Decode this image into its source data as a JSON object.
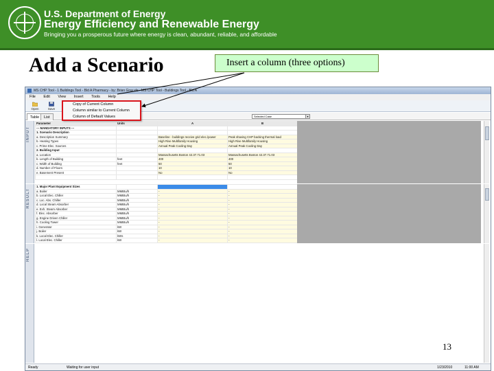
{
  "banner": {
    "line1": "U.S. Department of Energy",
    "line2": "Energy Efficiency and Renewable Energy",
    "line3": "Bringing you a prosperous future where energy is clean, abundant, reliable, and affordable",
    "color": "#3e8f27"
  },
  "slide": {
    "title": "Add a Scenario",
    "callout": "Insert a column (three options)",
    "callout_color": "#ccffcc",
    "page_number": "13",
    "highlight_color": "#d9141b"
  },
  "app": {
    "window_title": "MS CHP Tool - 1 Buildings Tool - Bld A Pharmacy - by: Brian Gray.xls - MS CHP Tool - Buildings Tool - Bld A",
    "menu": [
      "File",
      "Edit",
      "View",
      "Insert",
      "Tools",
      "Help"
    ],
    "toolbar": {
      "open": "Open",
      "save": "Save"
    },
    "dropdown_items": [
      "Copy of Current Column",
      "Column similar to Current Column",
      "Column of Default Values"
    ],
    "tabs": [
      "Table",
      "List"
    ],
    "scenario_select": "Selected Case",
    "sections": {
      "input": "INPUT",
      "result": "RESULT",
      "help": "HELP"
    },
    "columns": {
      "parameter": "Parameter",
      "units": "Units",
      "a": "A",
      "b": "B"
    },
    "input_rows": [
      {
        "p": "--- MANDATORY INPUTS ---",
        "u": "",
        "a": "",
        "b": "",
        "hdr": true
      },
      {
        "p": "1.  Scenario Description",
        "u": "",
        "a": "",
        "b": "",
        "hdr": true
      },
      {
        "p": "  a.  Description Summary",
        "u": "",
        "a": "Baseline - buildings receive grid elec./power",
        "b": "Peak shaving CHP backing thermal load"
      },
      {
        "p": "  b.  Heating Types",
        "u": "",
        "a": "High Rise Multifamily Housing",
        "b": "High Rise Multifamily Housing"
      },
      {
        "p": "  c.  Prime Elec. Sources",
        "u": "",
        "a": "Annual Peak Cooling Day",
        "b": "Annual Peak Cooling Day"
      },
      {
        "p": "2.  Building Input",
        "u": "",
        "a": "",
        "b": "",
        "hdr": true
      },
      {
        "p": "  a.  Location",
        "u": "",
        "a": "Massachusetts Boston 42.37.71.03",
        "b": "Massachusetts Boston 42.37.71.03"
      },
      {
        "p": "  b.  Length of Building",
        "u": "feet",
        "a": "400",
        "b": "400"
      },
      {
        "p": "  c.  Width of Building",
        "u": "feet",
        "a": "50",
        "b": "50"
      },
      {
        "p": "  d.  Number of Floors",
        "u": "",
        "a": "10",
        "b": "10"
      },
      {
        "p": "  e.  Basement Present",
        "u": "",
        "a": "No",
        "b": "No"
      },
      {
        "p": "",
        "u": "",
        "a": "",
        "b": ""
      }
    ],
    "result_rows": [
      {
        "p": "1.  Major Plant Equipment Sizes",
        "u": "",
        "a": "",
        "b": "",
        "hdr": true
      },
      {
        "p": "  a.  Boiler",
        "u": "MMBtu/h",
        "a": "-",
        "b": "-"
      },
      {
        "p": "  b.  Local Elec. Chiller",
        "u": "MMBtu/h",
        "a": "-",
        "b": "-"
      },
      {
        "p": "  c.  Loc. Abs. Chiller",
        "u": "MMBtu/h",
        "a": "-",
        "b": "-"
      },
      {
        "p": "  d.  Local Steam Absorber",
        "u": "MMBtu/h",
        "a": "-",
        "b": "-"
      },
      {
        "p": "  e.  Exh. Steam Absorber",
        "u": "MMBtu/h",
        "a": "-",
        "b": "-"
      },
      {
        "p": "  f.  Elec. Absorber",
        "u": "MMBtu/h",
        "a": "-",
        "b": "-"
      },
      {
        "p": "  g.  Engine Driven Chiller",
        "u": "MMBtu/h",
        "a": "-",
        "b": "-"
      },
      {
        "p": "  h.  Cooling Tower",
        "u": "MMBtu/h",
        "a": "-",
        "b": "-"
      },
      {
        "p": "  i.  Generator",
        "u": "kW",
        "a": "-",
        "b": "-"
      },
      {
        "p": "  j.  Boiler",
        "u": "kW",
        "a": "-",
        "b": "-"
      },
      {
        "p": "  k.  Local Elec. Chiller",
        "u": "kWs",
        "a": "-",
        "b": "-"
      },
      {
        "p": "  l.  Local Elec. Chiller",
        "u": "kW",
        "a": "-",
        "b": "-"
      }
    ],
    "status": {
      "left": "Ready",
      "message": "Waiting for user input",
      "date": "1/23/2010",
      "time": "11:00 AM"
    }
  }
}
